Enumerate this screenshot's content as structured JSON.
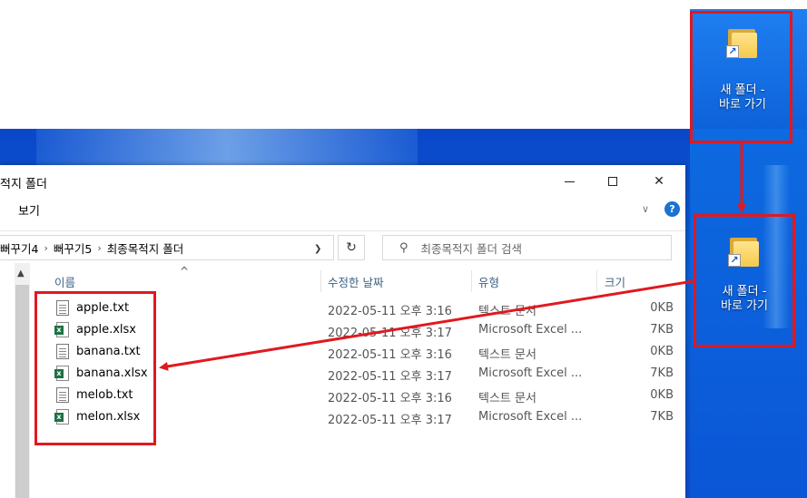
{
  "window": {
    "title": "적지 폴더",
    "view_menu": "보기"
  },
  "address": {
    "crumbs": [
      "뻐꾸기4",
      "뻐꾸기5",
      "최종목적지 폴더"
    ],
    "search_placeholder": "최종목적지 폴더 검색"
  },
  "columns": {
    "name": "이름",
    "date": "수정한 날짜",
    "type": "유형",
    "size": "크기"
  },
  "files": [
    {
      "name": "apple.txt",
      "date": "2022-05-11 오후 3:16",
      "type": "텍스트 문서",
      "size": "0KB",
      "kind": "txt"
    },
    {
      "name": "apple.xlsx",
      "date": "2022-05-11 오후 3:17",
      "type": "Microsoft Excel ...",
      "size": "7KB",
      "kind": "xlsx"
    },
    {
      "name": "banana.txt",
      "date": "2022-05-11 오후 3:16",
      "type": "텍스트 문서",
      "size": "0KB",
      "kind": "txt"
    },
    {
      "name": "banana.xlsx",
      "date": "2022-05-11 오후 3:17",
      "type": "Microsoft Excel ...",
      "size": "7KB",
      "kind": "xlsx"
    },
    {
      "name": "melob.txt",
      "date": "2022-05-11 오후 3:16",
      "type": "텍스트 문서",
      "size": "0KB",
      "kind": "txt"
    },
    {
      "name": "melon.xlsx",
      "date": "2022-05-11 오후 3:17",
      "type": "Microsoft Excel ...",
      "size": "7KB",
      "kind": "xlsx"
    }
  ],
  "desktop_shortcuts": [
    {
      "line1": "새 폴더 -",
      "line2": "바로 가기"
    },
    {
      "line1": "새 폴더 -",
      "line2": "바로 가기"
    }
  ],
  "colors": {
    "annotation_red": "#e0191f",
    "desktop_blue": "#0b5ed7",
    "help_blue": "#1a73d0"
  }
}
